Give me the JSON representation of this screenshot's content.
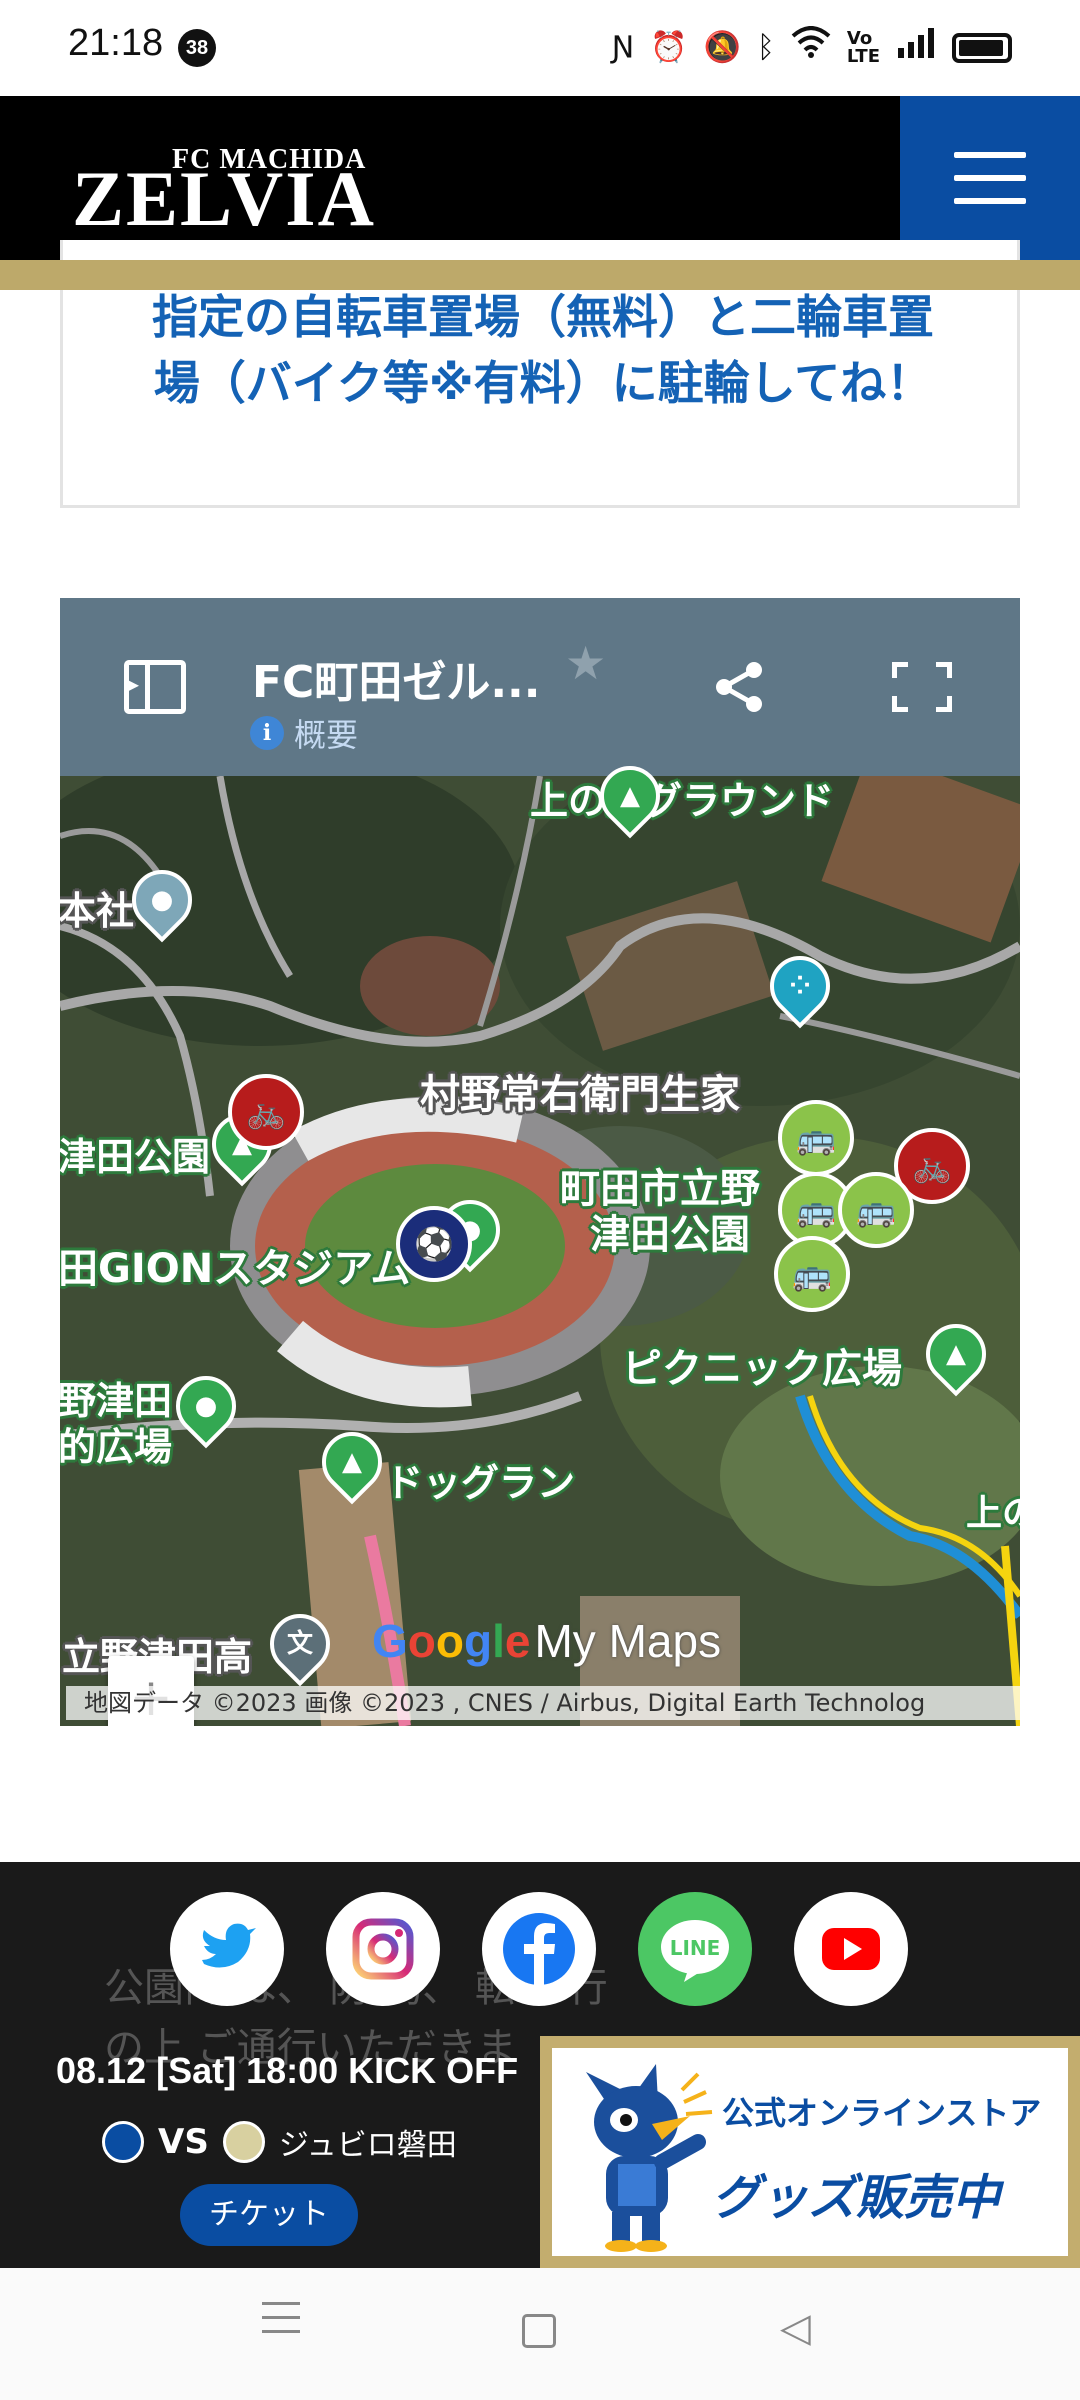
{
  "status_bar": {
    "time": "21:18",
    "notification_count": "38",
    "icons": [
      "nfc-icon",
      "alarm-icon",
      "mute-icon",
      "bluetooth-icon",
      "wifi-icon",
      "volte-icon",
      "signal-icon",
      "battery-icon"
    ]
  },
  "header": {
    "logo_top": "FC MACHIDA",
    "logo_main": "ZELVIA",
    "menu_icon": "hamburger-menu-icon",
    "colors": {
      "menu_bg": "#0a4da2",
      "accent_bar": "#bda96a"
    }
  },
  "notice": {
    "line1": "指定の自転車置場（無料）と二輪車置",
    "line2": "場（バイク等※有料）に駐輪してね！"
  },
  "map": {
    "title": "FC町田ゼル...",
    "info_label": "概要",
    "labels": {
      "ground": "上の丄グラウンド",
      "shrine": "本社",
      "house": "村野常右衛門生家",
      "park": "津田公園",
      "park_machida_1": "町田市立野",
      "park_machida_2": "津田公園",
      "stadium": "田GIONスタジアム",
      "picnic": "ピクニック広場",
      "plaza_1": "野津田",
      "plaza_2": "的広場",
      "dogrun": "ドッグラン",
      "school": "立野津田高",
      "upper": "上の"
    },
    "zoom_in": "+",
    "zoom_out": "−",
    "google_letters": [
      "G",
      "o",
      "o",
      "g",
      "l",
      "e"
    ],
    "mymaps": "My Maps",
    "attribution": "地図データ ©2023 画像 ©2023 , CNES / Airbus, Digital Earth Technolog"
  },
  "footer": {
    "text_line1": "公園内 は、      防      為、  転車      行",
    "text_line2": "の上  ご通行いただきま",
    "social": [
      {
        "name": "twitter-icon",
        "color": "#1da1f2"
      },
      {
        "name": "instagram-icon",
        "color": "#e1306c"
      },
      {
        "name": "facebook-icon",
        "color": "#1877f2"
      },
      {
        "name": "line-icon",
        "color": "#4cc764"
      },
      {
        "name": "youtube-icon",
        "color": "#ff0000"
      }
    ],
    "line_label": "LINE"
  },
  "match": {
    "date": "08.12 [Sat] 18:00 KICK OFF",
    "vs": "VS",
    "opponent": "ジュビロ磐田",
    "ticket": "チケット"
  },
  "store": {
    "title": "公式オンラインストア",
    "subtitle": "グッズ販売中"
  }
}
